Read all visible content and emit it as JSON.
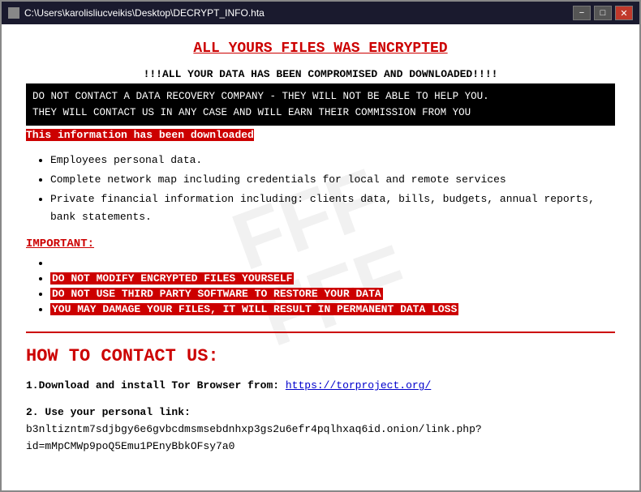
{
  "window": {
    "title": "C:\\Users\\karolisliucveikis\\Desktop\\DECRYPT_INFO.hta",
    "minimize_label": "−",
    "maximize_label": "□",
    "close_label": "✕"
  },
  "watermark": {
    "line1": "FFF",
    "line2": "FFF"
  },
  "content": {
    "main_title": "ALL YOURS FILES WAS ENCRYPTED",
    "exclaim_line": "!!!ALL YOUR DATA HAS BEEN COMPROMISED AND DOWNLOADED!!!!",
    "black_box_line1": "DO NOT CONTACT A DATA RECOVERY COMPANY - THEY WILL NOT BE ABLE TO HELP YOU.",
    "black_box_line2": "THEY WILL CONTACT US IN ANY CASE AND WILL EARN THEIR COMMISSION FROM YOU",
    "downloaded_text": "This information has been downloaded",
    "bullet_items": [
      "Employees personal data.",
      "Complete network map including credentials for local and remote services",
      "Private financial information including: clients data, bills, budgets, annual reports, bank statements."
    ],
    "important_label": "IMPORTANT:",
    "important_items_red": [
      "DO NOT MODIFY ENCRYPTED FILES YOURSELF",
      "DO NOT USE THIRD PARTY SOFTWARE TO RESTORE YOUR DATA",
      "YOU MAY DAMAGE YOUR FILES, IT WILL RESULT IN PERMANENT DATA LOSS"
    ],
    "contact_heading": "HOW TO CONTACT US:",
    "step1_prefix": "1.Download and install Tor Browser from: ",
    "step1_link_text": "https://torproject.org/",
    "step1_link_url": "https://torproject.org/",
    "step2_line1": "2. Use your personal link:",
    "step2_link": "b3nltizntm7sdjbgy6e6gvbcdmsmsebdnhxp3gs2u6efr4pqlhxaq6id.onion/link.php?id=mMpCMWp9poQ5Emu1PEnyBbkOFsy7a0"
  }
}
